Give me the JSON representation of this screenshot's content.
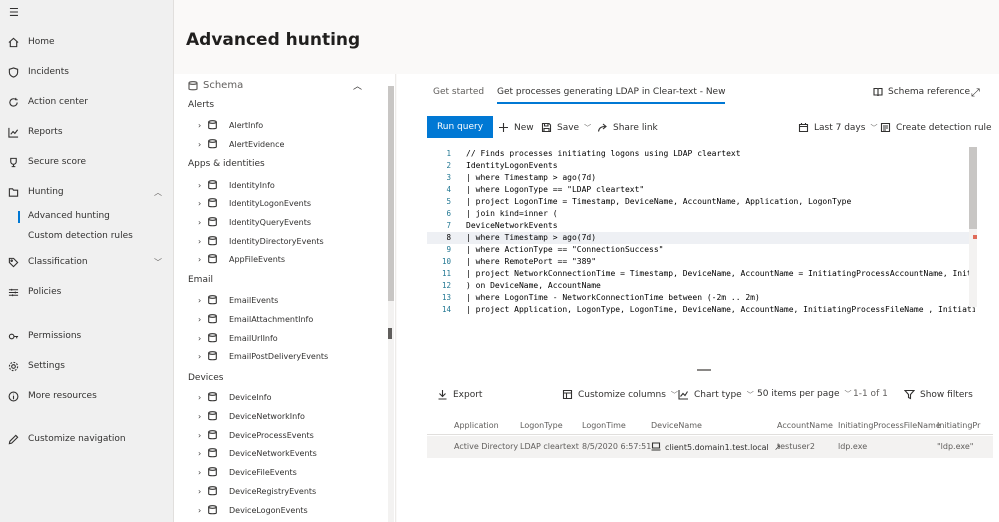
{
  "nav": {
    "items": [
      {
        "label": "Home",
        "icon": "home-icon"
      },
      {
        "label": "Incidents",
        "icon": "shield-icon"
      },
      {
        "label": "Action center",
        "icon": "refresh-icon"
      },
      {
        "label": "Reports",
        "icon": "chart-icon"
      },
      {
        "label": "Secure score",
        "icon": "trophy-icon"
      },
      {
        "label": "Hunting",
        "icon": "hunting-icon",
        "chevron": "^"
      },
      {
        "label": "Classification",
        "icon": "tag-icon",
        "chevron": "v"
      },
      {
        "label": "Policies",
        "icon": "sliders-icon"
      },
      {
        "label": "Permissions",
        "icon": "key-icon"
      },
      {
        "label": "Settings",
        "icon": "gear-icon"
      },
      {
        "label": "More resources",
        "icon": "info-icon"
      },
      {
        "label": "Customize navigation",
        "icon": "pencil-icon"
      }
    ],
    "sub_items": [
      "Advanced hunting",
      "Custom detection rules"
    ]
  },
  "page_title": "Advanced hunting",
  "schema": {
    "title": "Schema",
    "groups": [
      {
        "name": "Alerts",
        "tables": [
          "AlertInfo",
          "AlertEvidence"
        ]
      },
      {
        "name": "Apps & identities",
        "tables": [
          "IdentityInfo",
          "IdentityLogonEvents",
          "IdentityQueryEvents",
          "IdentityDirectoryEvents",
          "AppFileEvents"
        ]
      },
      {
        "name": "Email",
        "tables": [
          "EmailEvents",
          "EmailAttachmentInfo",
          "EmailUrlInfo",
          "EmailPostDeliveryEvents"
        ]
      },
      {
        "name": "Devices",
        "tables": [
          "DeviceInfo",
          "DeviceNetworkInfo",
          "DeviceProcessEvents",
          "DeviceNetworkEvents",
          "DeviceFileEvents",
          "DeviceRegistryEvents",
          "DeviceLogonEvents"
        ]
      }
    ]
  },
  "tabs": [
    "Get started",
    "Get processes generating LDAP in Clear-text - New"
  ],
  "schema_reference": "Schema reference",
  "toolbar": {
    "run": "Run query",
    "new": "New",
    "save": "Save",
    "share": "Share link",
    "time_range": "Last 7 days",
    "create_rule": "Create detection rule"
  },
  "editor": {
    "lines": [
      "// Finds processes initiating logons using LDAP cleartext",
      "IdentityLogonEvents",
      "| where Timestamp > ago(7d)",
      "| where LogonType == \"LDAP cleartext\"",
      "| project LogonTime = Timestamp, DeviceName, AccountName, Application, LogonType",
      "| join kind=inner (",
      "DeviceNetworkEvents",
      "| where Timestamp > ago(7d)",
      "| where ActionType == \"ConnectionSuccess\"",
      "| where RemotePort == \"389\"",
      "| project NetworkConnectionTime = Timestamp, DeviceName, AccountName = InitiatingProcessAccountName, Initi",
      ") on DeviceName, AccountName",
      "| where LogonTime - NetworkConnectionTime between (-2m .. 2m)",
      "| project Application, LogonType, LogonTime, DeviceName, AccountName, InitiatingProcessFileName , Initiati"
    ],
    "current_line": 8
  },
  "results": {
    "export": "Export",
    "customize_columns": "Customize columns",
    "chart_type": "Chart type",
    "items_per_page": "50 items per page",
    "paging": "1-1 of 1",
    "show_filters": "Show filters",
    "columns": [
      "Application",
      "LogonType",
      "LogonTime",
      "DeviceName",
      "AccountName",
      "InitiatingProcessFileName",
      "InitiatingPr"
    ],
    "rows": [
      [
        "Active Directory",
        "LDAP cleartext",
        "8/5/2020 6:57:51",
        "client5.domain1.test.local",
        "testuser2",
        "ldp.exe",
        "\"ldp.exe\""
      ]
    ]
  }
}
